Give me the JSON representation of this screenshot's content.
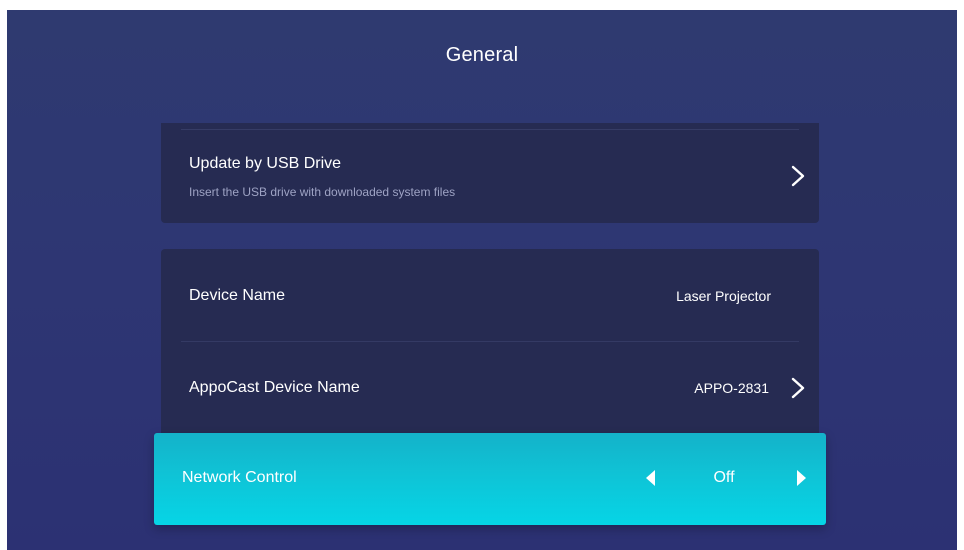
{
  "header": {
    "title": "General"
  },
  "rows": {
    "usb_update": {
      "title": "Update by USB Drive",
      "subtitle": "Insert the USB drive with downloaded system files",
      "icon": "chevron-right-icon"
    },
    "device_name": {
      "title": "Device Name",
      "value": "Laser Projector"
    },
    "appocast_name": {
      "title": "AppoCast Device Name",
      "value": "APPO-2831",
      "icon": "chevron-right-icon"
    },
    "network_control": {
      "title": "Network Control",
      "value": "Off",
      "left_icon": "triangle-left-icon",
      "right_icon": "triangle-right-icon"
    }
  },
  "colors": {
    "background": "#2e3773",
    "card": "#262b52",
    "focus": "#0fc3d6",
    "subtitle_text": "#9ea3c4"
  }
}
